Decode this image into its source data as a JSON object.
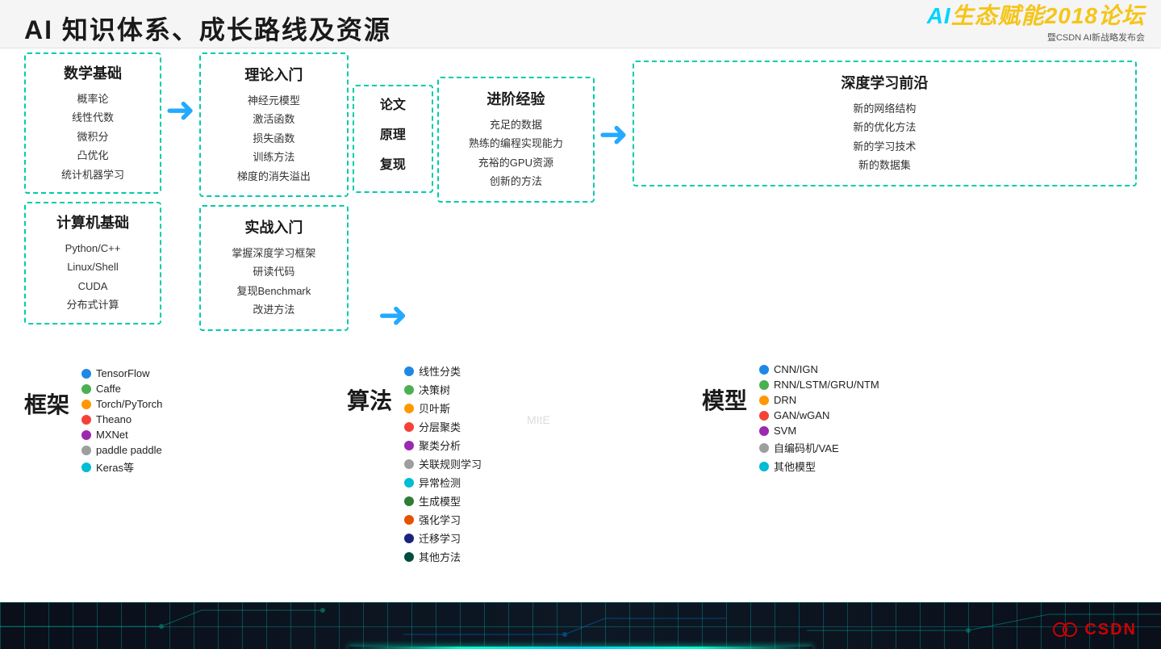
{
  "page": {
    "title": "AI 知识体系、成长路线及资源",
    "logo_title_prefix": "AI",
    "logo_title_main": "生态赋能2018论坛",
    "logo_subtitle": "暨CSDN AI新战略发布会"
  },
  "flow": {
    "col1": {
      "box1_title": "数学基础",
      "box1_items": [
        "概率论",
        "线性代数",
        "微积分",
        "凸优化",
        "统计机器学习"
      ],
      "box2_title": "计算机基础",
      "box2_items": [
        "Python/C++",
        "Linux/Shell",
        "CUDA",
        "分布式计算"
      ]
    },
    "col2": {
      "box1_title": "理论入门",
      "box1_items": [
        "神经元模型",
        "激活函数",
        "损失函数",
        "训练方法",
        "梯度的消失溢出"
      ],
      "box2_title": "实战入门",
      "box2_items": [
        "掌握深度学习框架",
        "研读代码",
        "复现Benchmark",
        "改进方法"
      ]
    },
    "paper_box": {
      "lines": [
        "论文",
        "原理",
        "复现"
      ]
    },
    "col3": {
      "title": "进阶经验",
      "items": [
        "充足的数据",
        "熟练的编程实现能力",
        "充裕的GPU资源",
        "创新的方法"
      ]
    },
    "col4": {
      "title": "深度学习前沿",
      "items": [
        "新的网络结构",
        "新的优化方法",
        "新的学习技术",
        "新的数据集"
      ]
    }
  },
  "frameworks": {
    "label": "框架",
    "items": [
      {
        "color": "#1e88e5",
        "name": "TensorFlow"
      },
      {
        "color": "#4caf50",
        "name": "Caffe"
      },
      {
        "color": "#ff9800",
        "name": "Torch/PyTorch"
      },
      {
        "color": "#f44336",
        "name": "Theano"
      },
      {
        "color": "#9c27b0",
        "name": "MXNet"
      },
      {
        "color": "#9e9e9e",
        "name": "paddle paddle"
      },
      {
        "color": "#00bcd4",
        "name": "Keras等"
      }
    ]
  },
  "algorithms": {
    "label": "算法",
    "items": [
      {
        "color": "#1e88e5",
        "name": "线性分类"
      },
      {
        "color": "#4caf50",
        "name": "决策树"
      },
      {
        "color": "#ff9800",
        "name": "贝叶斯"
      },
      {
        "color": "#f44336",
        "name": "分层聚类"
      },
      {
        "color": "#9c27b0",
        "name": "聚类分析"
      },
      {
        "color": "#9e9e9e",
        "name": "关联规则学习"
      },
      {
        "color": "#00bcd4",
        "name": "异常检测"
      },
      {
        "color": "#2e7d32",
        "name": "生成模型"
      },
      {
        "color": "#e65100",
        "name": "强化学习"
      },
      {
        "color": "#1a237e",
        "name": "迁移学习"
      },
      {
        "color": "#004d40",
        "name": "其他方法"
      }
    ]
  },
  "models": {
    "label": "模型",
    "items": [
      {
        "color": "#1e88e5",
        "name": "CNN/IGN"
      },
      {
        "color": "#4caf50",
        "name": "RNN/LSTM/GRU/NTM"
      },
      {
        "color": "#ff9800",
        "name": "DRN"
      },
      {
        "color": "#f44336",
        "name": "GAN/wGAN"
      },
      {
        "color": "#9c27b0",
        "name": "SVM"
      },
      {
        "color": "#9e9e9e",
        "name": "自编码机/VAE"
      },
      {
        "color": "#00bcd4",
        "name": "其他模型"
      }
    ]
  },
  "mite_watermark": "MItE",
  "csdn_label": "CSDN"
}
